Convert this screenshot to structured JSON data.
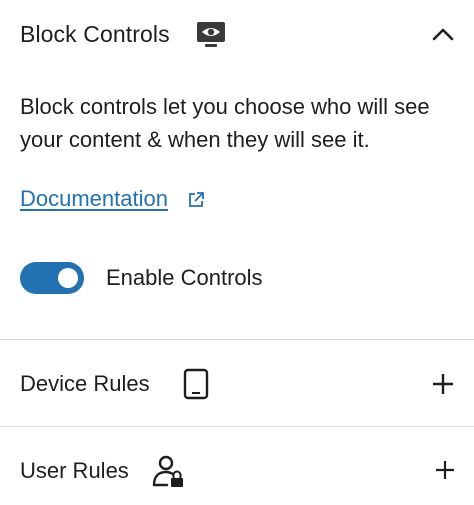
{
  "header": {
    "title": "Block Controls",
    "icon": "eye-monitor-icon",
    "collapse_icon": "chevron-up-icon"
  },
  "description": "Block controls let you choose who will see your content & when they will see it.",
  "documentation": {
    "label": "Documentation",
    "icon": "external-link-icon"
  },
  "enable_controls": {
    "label": "Enable Controls",
    "enabled": true
  },
  "sections": [
    {
      "title": "Device Rules",
      "icon": "tablet-device-icon",
      "action_icon": "plus-icon"
    },
    {
      "title": "User Rules",
      "icon": "user-lock-icon",
      "action_icon": "plus-icon"
    }
  ],
  "colors": {
    "accent": "#2271b1",
    "text": "#1e1e1e",
    "divider": "#dddddd"
  }
}
